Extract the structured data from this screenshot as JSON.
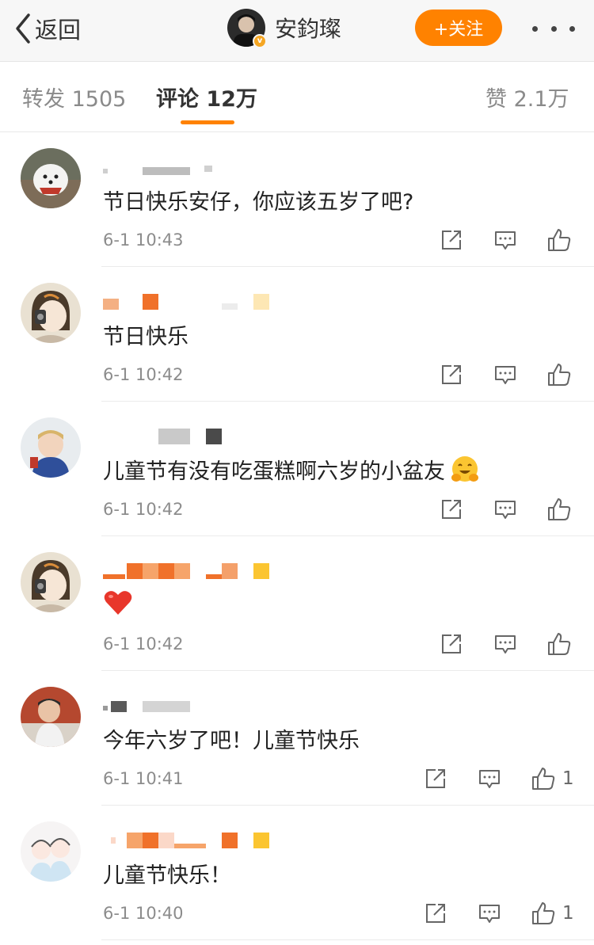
{
  "header": {
    "back_label": "返回",
    "profile_name": "安鈞璨",
    "verified_mark": "v",
    "follow_label": "+关注"
  },
  "tabs": [
    {
      "label": "转发 1505",
      "active": false
    },
    {
      "label": "评论 12万",
      "active": true
    },
    {
      "label": "赞 2.1万",
      "active": false
    }
  ],
  "comments": [
    {
      "text": "节日快乐安仔，你应该五岁了吧?",
      "time": "6-1 10:43",
      "likes": "",
      "avatar": "white-dog-avatar"
    },
    {
      "text": "节日快乐",
      "time": "6-1 10:42",
      "likes": "",
      "avatar": "cartoon-girl-avatar"
    },
    {
      "text": "儿童节有没有吃蛋糕啊六岁的小盆友",
      "time": "6-1 10:42",
      "likes": "",
      "avatar": "child-avatar",
      "emoji": "hugging-face-emoji"
    },
    {
      "text": "",
      "time": "6-1 10:42",
      "likes": "",
      "avatar": "cartoon-girl-avatar",
      "emoji": "red-heart-emoji"
    },
    {
      "text": "今年六岁了吧！儿童节快乐",
      "time": "6-1 10:41",
      "likes": "1",
      "avatar": "toddler-avatar"
    },
    {
      "text": "儿童节快乐！",
      "time": "6-1 10:40",
      "likes": "1",
      "avatar": "cartoon-couple-avatar"
    }
  ],
  "icons": [
    "chevron-left-icon",
    "verified-icon",
    "more-icon",
    "repost-icon",
    "reply-icon",
    "like-icon"
  ],
  "colors": {
    "accent": "#ff8200",
    "verified": "#f5a623",
    "muted_text": "#8c8c8c",
    "icon": "#666666"
  }
}
